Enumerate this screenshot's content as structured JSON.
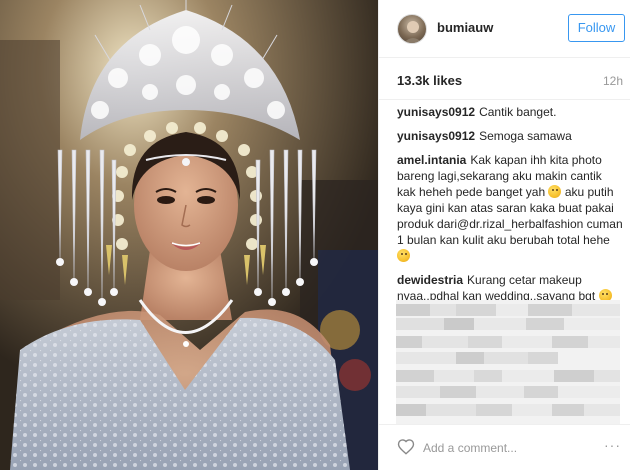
{
  "post": {
    "username": "bumiauw",
    "follow_label": "Follow",
    "likes": "13.3k likes",
    "time": "12h"
  },
  "comments": [
    {
      "user": "yunisays0912",
      "text": "Cantik banget.",
      "emoji_after": false
    },
    {
      "user": "yunisays0912",
      "text": "Semoga samawa",
      "emoji_after": false
    },
    {
      "user": "amel.intania",
      "text_a": "Kak kapan ihh kita photo bareng lagi,sekarang aku makin cantik kak heheh pede banget yah",
      "text_b": "aku putih kaya gini kan atas saran kaka buat pakai produk dari@dr.rizal_herbalfashion cuman 1 bulan kan kulit aku berubah total hehe"
    },
    {
      "user": "dewidestria",
      "text": "Kurang cetar makeup nyaa..pdhal kan wedding..sayang bgt"
    }
  ],
  "add_comment": {
    "placeholder": "Add a comment..."
  },
  "more_label": "···",
  "icons": {
    "heart": "heart-icon",
    "avatar": "avatar",
    "emoji": "smiley-emoji-icon"
  },
  "colors": {
    "follow_blue": "#3897f0",
    "border": "#efefef",
    "muted": "#999999"
  }
}
